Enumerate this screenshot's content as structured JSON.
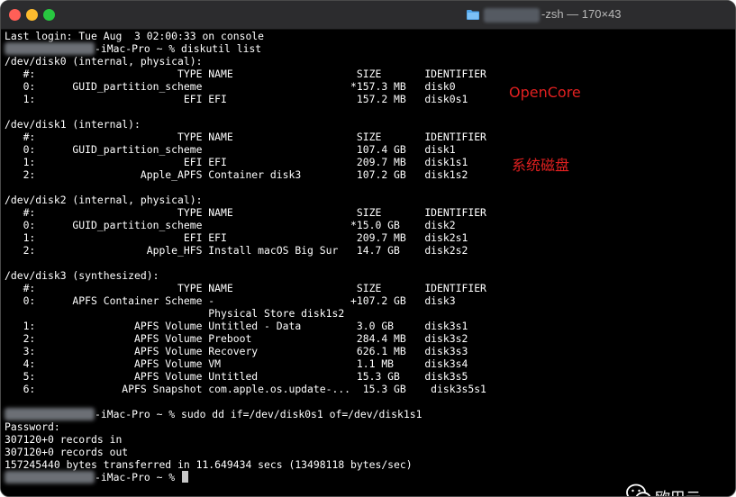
{
  "window": {
    "title": "-zsh — 170×43"
  },
  "terminal": {
    "login": "Last login: Tue Aug  3 02:00:33 on console",
    "prompt_suffix": "-iMac-Pro ~ % ",
    "cmd1": "diskutil list",
    "body": [
      "/dev/disk0 (internal, physical):",
      "   #:                       TYPE NAME                    SIZE       IDENTIFIER",
      "   0:      GUID_partition_scheme                        *157.3 MB   disk0",
      "   1:                        EFI EFI                     157.2 MB   disk0s1",
      "",
      "/dev/disk1 (internal):",
      "   #:                       TYPE NAME                    SIZE       IDENTIFIER",
      "   0:      GUID_partition_scheme                         107.4 GB   disk1",
      "   1:                        EFI EFI                     209.7 MB   disk1s1",
      "   2:                 Apple_APFS Container disk3         107.2 GB   disk1s2",
      "",
      "/dev/disk2 (internal, physical):",
      "   #:                       TYPE NAME                    SIZE       IDENTIFIER",
      "   0:      GUID_partition_scheme                        *15.0 GB    disk2",
      "   1:                        EFI EFI                     209.7 MB   disk2s1",
      "   2:                  Apple_HFS Install macOS Big Sur   14.7 GB    disk2s2",
      "",
      "/dev/disk3 (synthesized):",
      "   #:                       TYPE NAME                    SIZE       IDENTIFIER",
      "   0:      APFS Container Scheme -                      +107.2 GB   disk3",
      "                                 Physical Store disk1s2",
      "   1:                APFS Volume Untitled - Data         3.0 GB     disk3s1",
      "   2:                APFS Volume Preboot                 284.4 MB   disk3s2",
      "   3:                APFS Volume Recovery                626.1 MB   disk3s3",
      "   4:                APFS Volume VM                      1.1 MB     disk3s4",
      "   5:                APFS Volume Untitled                15.3 GB    disk3s5",
      "   6:              APFS Snapshot com.apple.os.update-...  15.3 GB    disk3s5s1",
      ""
    ],
    "cmd2": "sudo dd if=/dev/disk0s1 of=/dev/disk1s1",
    "tail": [
      "Password:",
      "307120+0 records in",
      "307120+0 records out",
      "157245440 bytes transferred in 11.649434 secs (13498118 bytes/sec)"
    ],
    "cmd3": ""
  },
  "annotations": {
    "opencore": "OpenCore",
    "system_disk": "系统磁盘"
  },
  "watermark": {
    "text": "欧巴云",
    "icon": "wechat-icon"
  },
  "colors": {
    "close": "#ff5f57",
    "minimize": "#febc2e",
    "maximize": "#28c840",
    "annotation": "#e02020",
    "terminal_bg": "#000000",
    "terminal_fg": "#ffffff"
  }
}
